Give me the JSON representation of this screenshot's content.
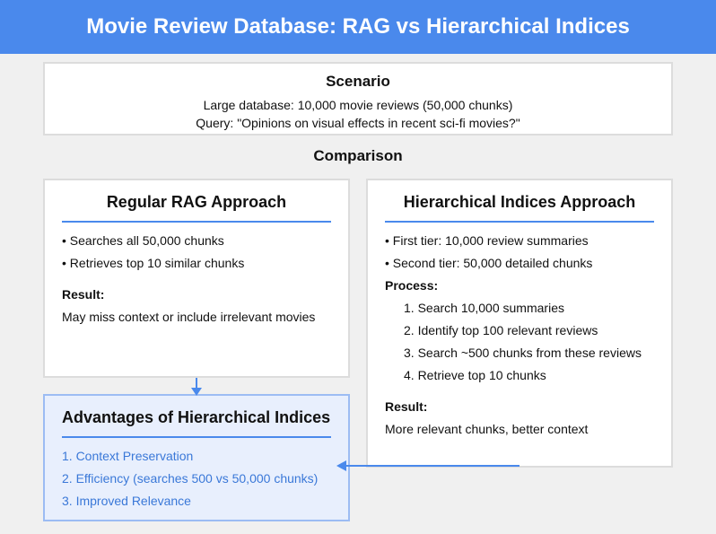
{
  "header": {
    "title": "Movie Review Database: RAG vs Hierarchical Indices"
  },
  "scenario": {
    "title": "Scenario",
    "line1": "Large database: 10,000 movie reviews (50,000 chunks)",
    "line2": "Query: \"Opinions on visual effects in recent sci-fi movies?\""
  },
  "comparison": {
    "title": "Comparison"
  },
  "rag": {
    "title": "Regular RAG Approach",
    "bullets": [
      "• Searches all 50,000 chunks",
      "• Retrieves top 10 similar chunks"
    ],
    "result_label": "Result:",
    "result_text": "May miss context or include irrelevant movies"
  },
  "hierarchical": {
    "title": "Hierarchical Indices Approach",
    "bullets": [
      "• First tier: 10,000 review summaries",
      "• Second tier: 50,000 detailed chunks"
    ],
    "process_label": "Process:",
    "steps": [
      "1. Search 10,000 summaries",
      "2. Identify top 100 relevant reviews",
      "3. Search ~500 chunks from these reviews",
      "4. Retrieve top 10 chunks"
    ],
    "result_label": "Result:",
    "result_text": "More relevant chunks, better context"
  },
  "advantages": {
    "title": "Advantages of Hierarchical Indices",
    "items": [
      "1. Context Preservation",
      "2. Efficiency (searches 500 vs 50,000 chunks)",
      "3. Improved Relevance"
    ]
  },
  "colors": {
    "header_bg": "#4a89ec",
    "accent": "#4a89ec",
    "advantage_bg": "#e8effd",
    "advantage_text": "#3a78d8"
  }
}
